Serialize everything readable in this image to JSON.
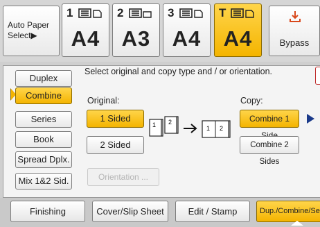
{
  "paper_trays": {
    "auto_paper_line1": "Auto Paper",
    "auto_paper_line2": "Select▶",
    "trays": [
      {
        "number": "1",
        "size": "A4",
        "selected": false
      },
      {
        "number": "2",
        "size": "A3",
        "selected": false
      },
      {
        "number": "3",
        "size": "A4",
        "selected": false
      },
      {
        "number": "T",
        "size": "A4",
        "selected": true
      }
    ],
    "bypass_label": "Bypass"
  },
  "sidebar": {
    "items": [
      {
        "label": "Duplex",
        "selected": false
      },
      {
        "label": "Combine",
        "selected": true
      },
      {
        "label": "Series",
        "selected": false
      },
      {
        "label": "Book",
        "selected": false
      },
      {
        "label": "Spread Dplx.",
        "selected": false
      },
      {
        "label": "Mix 1&2 Sid.",
        "selected": false
      }
    ]
  },
  "main": {
    "instruction": "Select original and copy type and / or orientation.",
    "original_label": "Original:",
    "copy_label": "Copy:",
    "original_options": [
      "1 Sided",
      "2 Sided"
    ],
    "copy_options": [
      "Combine 1 Side",
      "Combine 2 Sides"
    ],
    "orientation_label": "Orientation ...",
    "diagram": {
      "source_page_numbers": [
        "1",
        "2"
      ],
      "result_page_numbers": [
        "1",
        "2"
      ]
    }
  },
  "tabs": [
    {
      "label": "Finishing",
      "selected": false
    },
    {
      "label": "Cover/Slip Sheet",
      "selected": false
    },
    {
      "label": "Edit / Stamp",
      "selected": false
    },
    {
      "label": "Dup./Combine/Ser",
      "selected": true
    }
  ],
  "colors": {
    "accent": "#f4b400",
    "panel": "#f4f4f4",
    "chrome": "#d6d6d6",
    "bypass_icon": "#d9481b",
    "play_arrow": "#1a3a8a"
  }
}
